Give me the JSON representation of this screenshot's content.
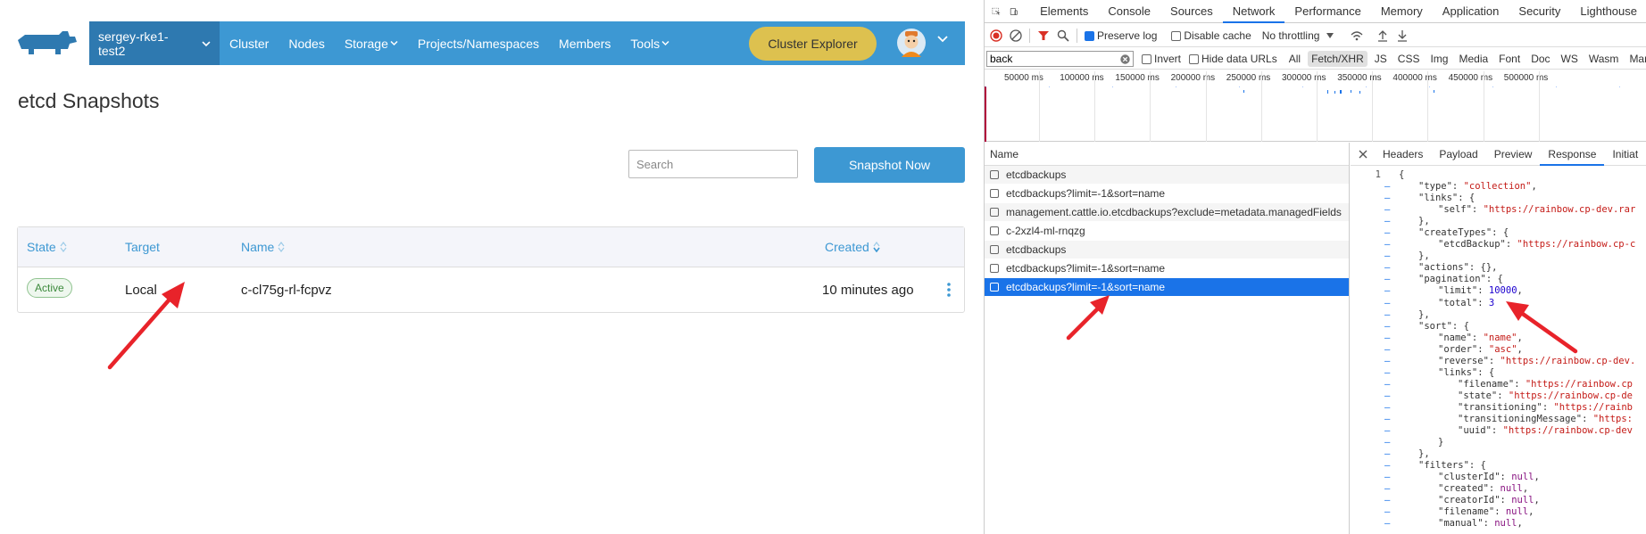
{
  "app": {
    "cluster_name": "sergey-rke1-test2",
    "nav": [
      {
        "label": "Cluster",
        "has_caret": false
      },
      {
        "label": "Nodes",
        "has_caret": false
      },
      {
        "label": "Storage",
        "has_caret": true
      },
      {
        "label": "Projects/Namespaces",
        "has_caret": false
      },
      {
        "label": "Members",
        "has_caret": false
      },
      {
        "label": "Tools",
        "has_caret": true
      }
    ],
    "cluster_explorer_label": "Cluster Explorer",
    "page_title": "etcd Snapshots",
    "search_placeholder": "Search",
    "snapshot_now_label": "Snapshot Now",
    "table": {
      "columns": [
        "State",
        "Target",
        "Name",
        "Created"
      ],
      "rows": [
        {
          "state": "Active",
          "target": "Local",
          "name": "c-cl75g-rl-fcpvz",
          "created": "10 minutes ago"
        }
      ]
    },
    "colors": {
      "nav_bg": "#3d98d3",
      "cluster_bg": "#2e79b0",
      "explorer_btn": "#ddc14f",
      "arrow": "#e8232a"
    }
  },
  "devtools": {
    "tabs": [
      "Elements",
      "Console",
      "Sources",
      "Network",
      "Performance",
      "Memory",
      "Application",
      "Security",
      "Lighthouse"
    ],
    "active_tab": "Network",
    "preserve_log_label": "Preserve log",
    "disable_cache_label": "Disable cache",
    "throttling_label": "No throttling",
    "filter_value": "back",
    "invert_label": "Invert",
    "hide_data_urls_label": "Hide data URLs",
    "type_filters": [
      "All",
      "Fetch/XHR",
      "JS",
      "CSS",
      "Img",
      "Media",
      "Font",
      "Doc",
      "WS",
      "Wasm",
      "Mani"
    ],
    "active_type_filter": "Fetch/XHR",
    "timeline_labels": [
      "50000 ms",
      "100000 ms",
      "150000 ms",
      "200000 ms",
      "250000 ms",
      "300000 ms",
      "350000 ms",
      "400000 ms",
      "450000 ms",
      "500000 ms"
    ],
    "name_header": "Name",
    "requests": [
      "etcdbackups",
      "etcdbackups?limit=-1&sort=name",
      "management.cattle.io.etcdbackups?exclude=metadata.managedFields",
      "c-2xzl4-ml-rnqzg",
      "etcdbackups",
      "etcdbackups?limit=-1&sort=name",
      "etcdbackups?limit=-1&sort=name"
    ],
    "selected_request_index": 6,
    "response_tabs": [
      "Headers",
      "Payload",
      "Preview",
      "Response",
      "Initiat"
    ],
    "active_response_tab": "Response",
    "response_lines": [
      {
        "ind": 0,
        "t": [
          {
            "k": "p",
            "v": "{"
          }
        ]
      },
      {
        "ind": 1,
        "t": [
          {
            "k": "p",
            "v": "\"type\": "
          },
          {
            "k": "s",
            "v": "\"collection\""
          },
          {
            "k": "p",
            "v": ","
          }
        ]
      },
      {
        "ind": 1,
        "t": [
          {
            "k": "p",
            "v": "\"links\": {"
          }
        ]
      },
      {
        "ind": 2,
        "t": [
          {
            "k": "p",
            "v": "\"self\": "
          },
          {
            "k": "s",
            "v": "\"https://rainbow.cp-dev.rar"
          }
        ]
      },
      {
        "ind": 1,
        "t": [
          {
            "k": "p",
            "v": "},"
          }
        ]
      },
      {
        "ind": 1,
        "t": [
          {
            "k": "p",
            "v": "\"createTypes\": {"
          }
        ]
      },
      {
        "ind": 2,
        "t": [
          {
            "k": "p",
            "v": "\"etcdBackup\": "
          },
          {
            "k": "s",
            "v": "\"https://rainbow.cp-c"
          }
        ]
      },
      {
        "ind": 1,
        "t": [
          {
            "k": "p",
            "v": "},"
          }
        ]
      },
      {
        "ind": 1,
        "t": [
          {
            "k": "p",
            "v": "\"actions\": {},"
          }
        ]
      },
      {
        "ind": 1,
        "t": [
          {
            "k": "p",
            "v": "\"pagination\": {"
          }
        ]
      },
      {
        "ind": 2,
        "t": [
          {
            "k": "p",
            "v": "\"limit\": "
          },
          {
            "k": "n",
            "v": "10000"
          },
          {
            "k": "p",
            "v": ","
          }
        ]
      },
      {
        "ind": 2,
        "t": [
          {
            "k": "p",
            "v": "\"total\": "
          },
          {
            "k": "n",
            "v": "3"
          }
        ]
      },
      {
        "ind": 1,
        "t": [
          {
            "k": "p",
            "v": "},"
          }
        ]
      },
      {
        "ind": 1,
        "t": [
          {
            "k": "p",
            "v": "\"sort\": {"
          }
        ]
      },
      {
        "ind": 2,
        "t": [
          {
            "k": "p",
            "v": "\"name\": "
          },
          {
            "k": "s",
            "v": "\"name\""
          },
          {
            "k": "p",
            "v": ","
          }
        ]
      },
      {
        "ind": 2,
        "t": [
          {
            "k": "p",
            "v": "\"order\": "
          },
          {
            "k": "s",
            "v": "\"asc\""
          },
          {
            "k": "p",
            "v": ","
          }
        ]
      },
      {
        "ind": 2,
        "t": [
          {
            "k": "p",
            "v": "\"reverse\": "
          },
          {
            "k": "s",
            "v": "\"https://rainbow.cp-dev."
          }
        ]
      },
      {
        "ind": 2,
        "t": [
          {
            "k": "p",
            "v": "\"links\": {"
          }
        ]
      },
      {
        "ind": 3,
        "t": [
          {
            "k": "p",
            "v": "\"filename\": "
          },
          {
            "k": "s",
            "v": "\"https://rainbow.cp"
          }
        ]
      },
      {
        "ind": 3,
        "t": [
          {
            "k": "p",
            "v": "\"state\": "
          },
          {
            "k": "s",
            "v": "\"https://rainbow.cp-de"
          }
        ]
      },
      {
        "ind": 3,
        "t": [
          {
            "k": "p",
            "v": "\"transitioning\": "
          },
          {
            "k": "s",
            "v": "\"https://rainb"
          }
        ]
      },
      {
        "ind": 3,
        "t": [
          {
            "k": "p",
            "v": "\"transitioningMessage\": "
          },
          {
            "k": "s",
            "v": "\"https:"
          }
        ]
      },
      {
        "ind": 3,
        "t": [
          {
            "k": "p",
            "v": "\"uuid\": "
          },
          {
            "k": "s",
            "v": "\"https://rainbow.cp-dev"
          }
        ]
      },
      {
        "ind": 2,
        "t": [
          {
            "k": "p",
            "v": "}"
          }
        ]
      },
      {
        "ind": 1,
        "t": [
          {
            "k": "p",
            "v": "},"
          }
        ]
      },
      {
        "ind": 1,
        "t": [
          {
            "k": "p",
            "v": "\"filters\": {"
          }
        ]
      },
      {
        "ind": 2,
        "t": [
          {
            "k": "p",
            "v": "\"clusterId\": "
          },
          {
            "k": "u",
            "v": "null"
          },
          {
            "k": "p",
            "v": ","
          }
        ]
      },
      {
        "ind": 2,
        "t": [
          {
            "k": "p",
            "v": "\"created\": "
          },
          {
            "k": "u",
            "v": "null"
          },
          {
            "k": "p",
            "v": ","
          }
        ]
      },
      {
        "ind": 2,
        "t": [
          {
            "k": "p",
            "v": "\"creatorId\": "
          },
          {
            "k": "u",
            "v": "null"
          },
          {
            "k": "p",
            "v": ","
          }
        ]
      },
      {
        "ind": 2,
        "t": [
          {
            "k": "p",
            "v": "\"filename\": "
          },
          {
            "k": "u",
            "v": "null"
          },
          {
            "k": "p",
            "v": ","
          }
        ]
      },
      {
        "ind": 2,
        "t": [
          {
            "k": "p",
            "v": "\"manual\": "
          },
          {
            "k": "u",
            "v": "null"
          },
          {
            "k": "p",
            "v": ","
          }
        ]
      }
    ],
    "first_line_number": "1"
  }
}
